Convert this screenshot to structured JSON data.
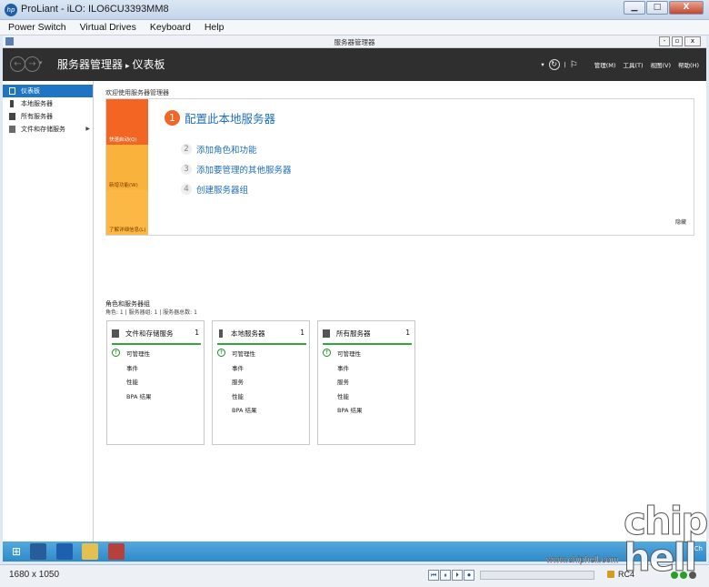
{
  "window": {
    "title": "ProLiant - iLO: ILO6CU3393MM8",
    "controls": [
      "▁",
      "□",
      "X"
    ]
  },
  "menubar": [
    "Power Switch",
    "Virtual Drives",
    "Keyboard",
    "Help"
  ],
  "server_manager": {
    "title": "服务器管理器",
    "controls": [
      "-",
      "▫",
      "x"
    ],
    "breadcrumb": {
      "app": "服务器管理器",
      "separator": "▸",
      "page": "仪表板"
    },
    "header_menu": [
      "管理(M)",
      "工具(T)",
      "视图(V)",
      "帮助(H)"
    ],
    "nav": [
      {
        "label": "仪表板",
        "selected": true
      },
      {
        "label": "本地服务器",
        "selected": false
      },
      {
        "label": "所有服务器",
        "selected": false
      },
      {
        "label": "文件和存储服务",
        "selected": false,
        "has_arrow": true
      }
    ],
    "welcome": {
      "label": "欢迎使用服务器管理器",
      "tiles": [
        "快速启动(Q)",
        "新增功能(W)",
        "了解详细信息(L)"
      ],
      "main_step": {
        "number": "1",
        "text": "配置此本地服务器"
      },
      "steps": [
        {
          "number": "2",
          "text": "添加角色和功能"
        },
        {
          "number": "3",
          "text": "添加要管理的其他服务器"
        },
        {
          "number": "4",
          "text": "创建服务器组"
        }
      ],
      "hide": "隐藏"
    },
    "roles": {
      "title": "角色和服务器组",
      "subtitle": "角色: 1 | 服务器组: 1 | 服务器总数: 1",
      "cards": [
        {
          "name": "文件和存储服务",
          "count": "1",
          "items": [
            "可管理性",
            "事件",
            "性能",
            "BPA 结果"
          ]
        },
        {
          "name": "本地服务器",
          "count": "1",
          "items": [
            "可管理性",
            "事件",
            "服务",
            "性能",
            "BPA 结果"
          ]
        },
        {
          "name": "所有服务器",
          "count": "1",
          "items": [
            "可管理性",
            "事件",
            "服务",
            "性能",
            "BPA 结果"
          ]
        }
      ]
    }
  },
  "taskbar": {
    "tray_text": "Ch"
  },
  "statusbar": {
    "resolution": "1680 x 1050",
    "media_controls": [
      "⏮",
      "⏸",
      "⏵",
      "⏺"
    ],
    "encryption": "RC4",
    "status_colors": [
      "#2a9d2a",
      "#2a9d2a",
      "#555555"
    ]
  },
  "watermark": {
    "logo": "chip hell",
    "url": "www.chiphell.com"
  }
}
